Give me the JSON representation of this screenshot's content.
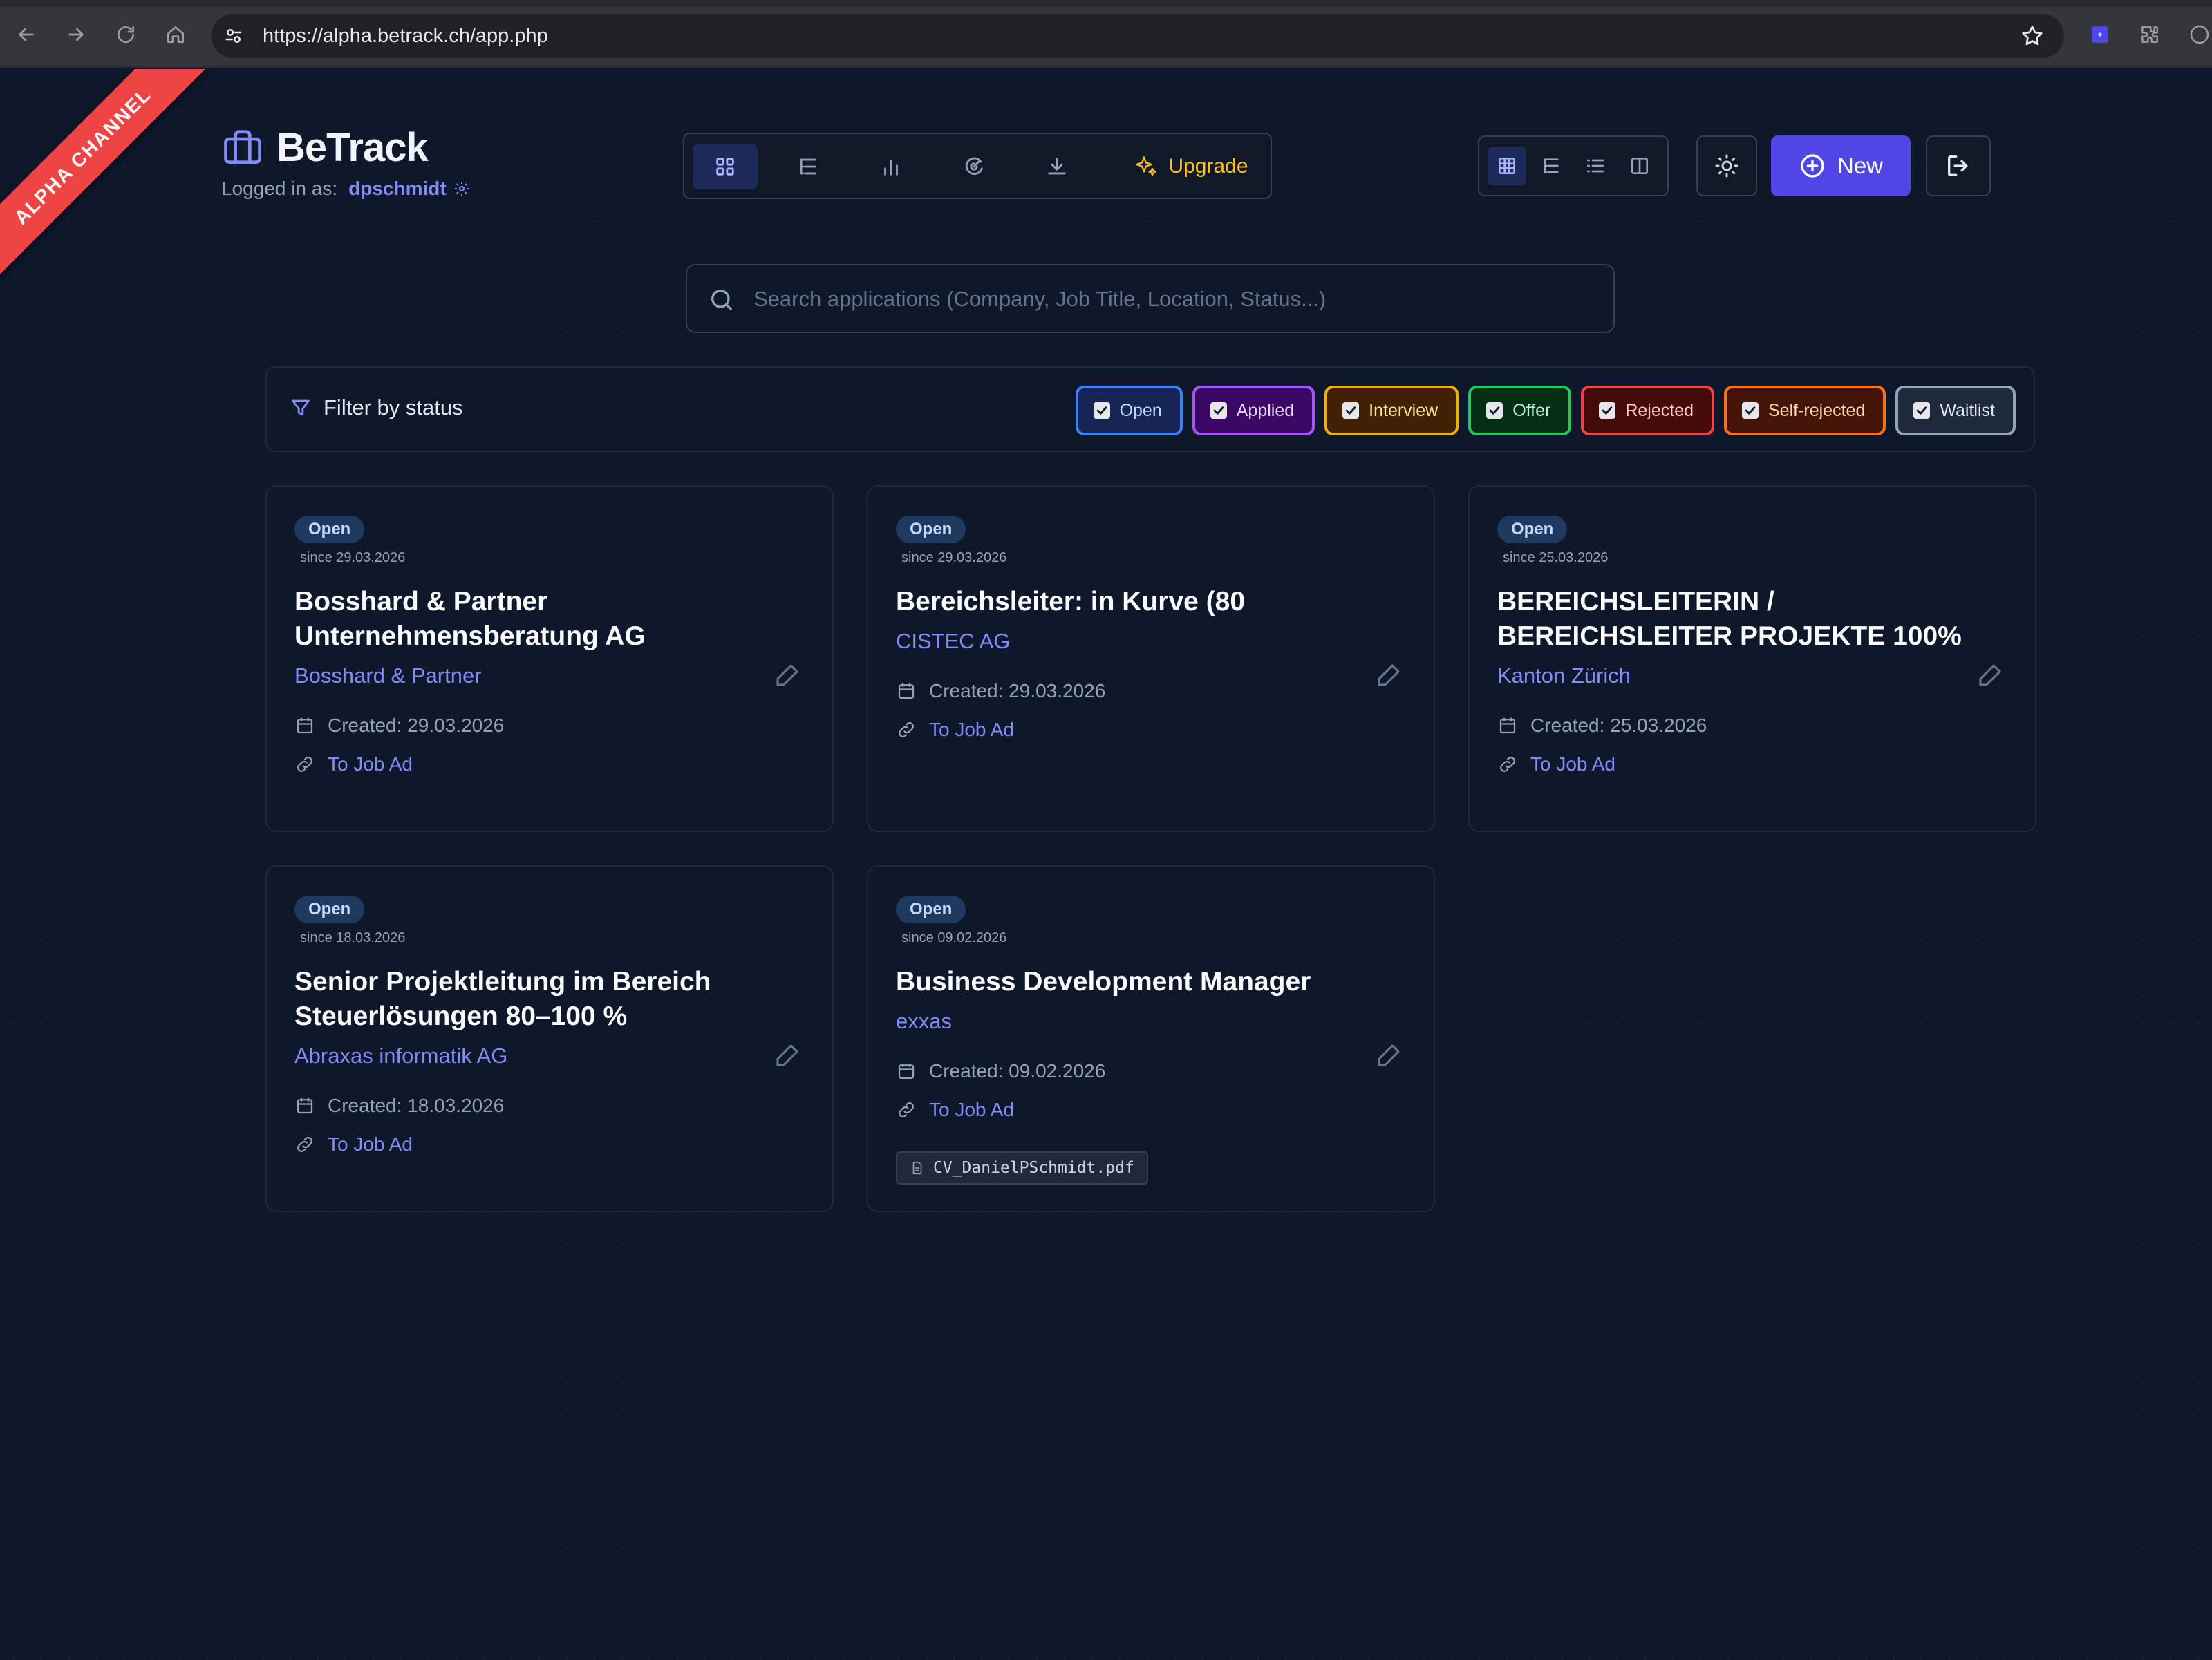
{
  "browser": {
    "url": "https://alpha.betrack.ch/app.php"
  },
  "ribbon": "ALPHA CHANNEL",
  "brand": {
    "title": "BeTrack",
    "logged_in_label": "Logged in as:",
    "username": "dpschmidt"
  },
  "toolbar": {
    "upgrade_label": "Upgrade"
  },
  "actions": {
    "new_label": "New"
  },
  "search": {
    "placeholder": "Search applications (Company, Job Title, Location, Status...)"
  },
  "filter": {
    "label": "Filter by status",
    "chips": [
      {
        "label": "Open",
        "checked": true,
        "color": "#3b82f6",
        "bg": "#172554",
        "text": "#bfdbfe"
      },
      {
        "label": "Applied",
        "checked": true,
        "color": "#a855f7",
        "bg": "#3b0764",
        "text": "#e9d5ff"
      },
      {
        "label": "Interview",
        "checked": true,
        "color": "#eab308",
        "bg": "#422006",
        "text": "#fde68a"
      },
      {
        "label": "Offer",
        "checked": true,
        "color": "#22c55e",
        "bg": "#052e16",
        "text": "#bbf7d0"
      },
      {
        "label": "Rejected",
        "checked": true,
        "color": "#ef4444",
        "bg": "#450a0a",
        "text": "#fecaca"
      },
      {
        "label": "Self-rejected",
        "checked": true,
        "color": "#f97316",
        "bg": "#431407",
        "text": "#fed7aa"
      },
      {
        "label": "Waitlist",
        "checked": true,
        "color": "#94a3b8",
        "bg": "#1e293b",
        "text": "#e2e8f0"
      }
    ]
  },
  "cards": [
    {
      "status": "Open",
      "since": "since 29.03.2026",
      "title": "Bosshard & Partner Unternehmensberatung AG",
      "company": "Bosshard & Partner",
      "created": "Created: 29.03.2026",
      "link": "To Job Ad"
    },
    {
      "status": "Open",
      "since": "since 29.03.2026",
      "title": "Bereichsleiter: in Kurve (80",
      "company": "CISTEC AG",
      "created": "Created: 29.03.2026",
      "link": "To Job Ad"
    },
    {
      "status": "Open",
      "since": "since 25.03.2026",
      "title": "BEREICHSLEITERIN / BEREICHSLEITER PROJEKTE 100%",
      "company": "Kanton Zürich",
      "created": "Created: 25.03.2026",
      "link": "To Job Ad"
    },
    {
      "status": "Open",
      "since": "since 18.03.2026",
      "title": "Senior Projektleitung im Bereich Steuerlösungen 80–100 %",
      "company": "Abraxas informatik AG",
      "created": "Created: 18.03.2026",
      "link": "To Job Ad"
    },
    {
      "status": "Open",
      "since": "since 09.02.2026",
      "title": "Business Development Manager",
      "company": "exxas",
      "created": "Created: 09.02.2026",
      "link": "To Job Ad",
      "file": "CV_DanielPSchmidt.pdf"
    }
  ]
}
